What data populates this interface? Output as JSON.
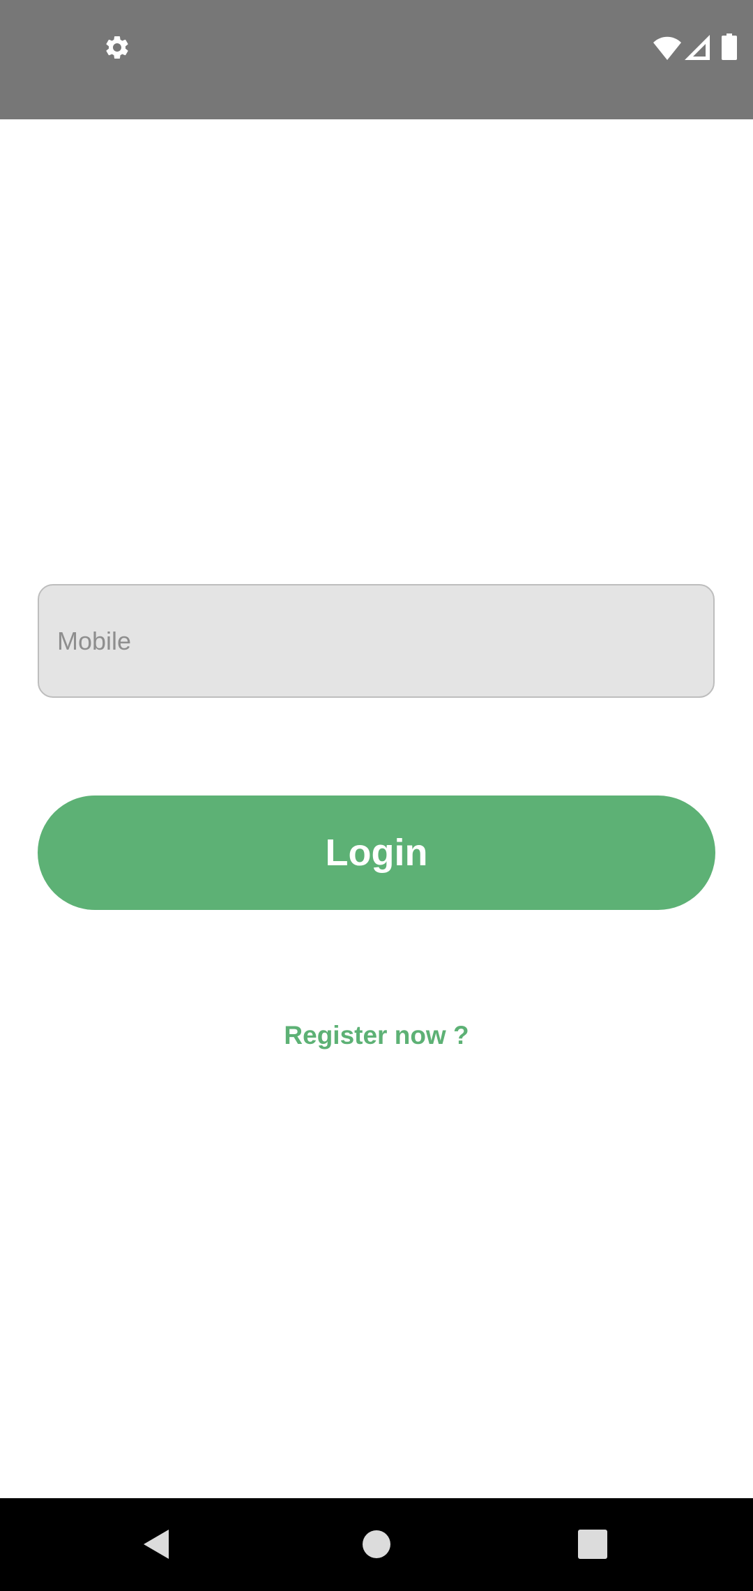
{
  "status_bar": {
    "background": "#777777",
    "icons": [
      "gear-icon",
      "wifi-icon",
      "cellular-signal-icon",
      "battery-icon"
    ]
  },
  "login_form": {
    "mobile_placeholder": "Mobile",
    "mobile_value": "",
    "login_label": "Login",
    "register_label": "Register now ?"
  },
  "navigation_bar": {
    "icons": [
      "back-icon",
      "home-icon",
      "recents-icon"
    ]
  },
  "colors": {
    "accent": "#5db175",
    "field_background": "#e4e4e4",
    "field_border": "#bdbdbd",
    "placeholder": "#8e8e8e",
    "page_background": "#ffffff",
    "navigation_background": "#000000"
  }
}
